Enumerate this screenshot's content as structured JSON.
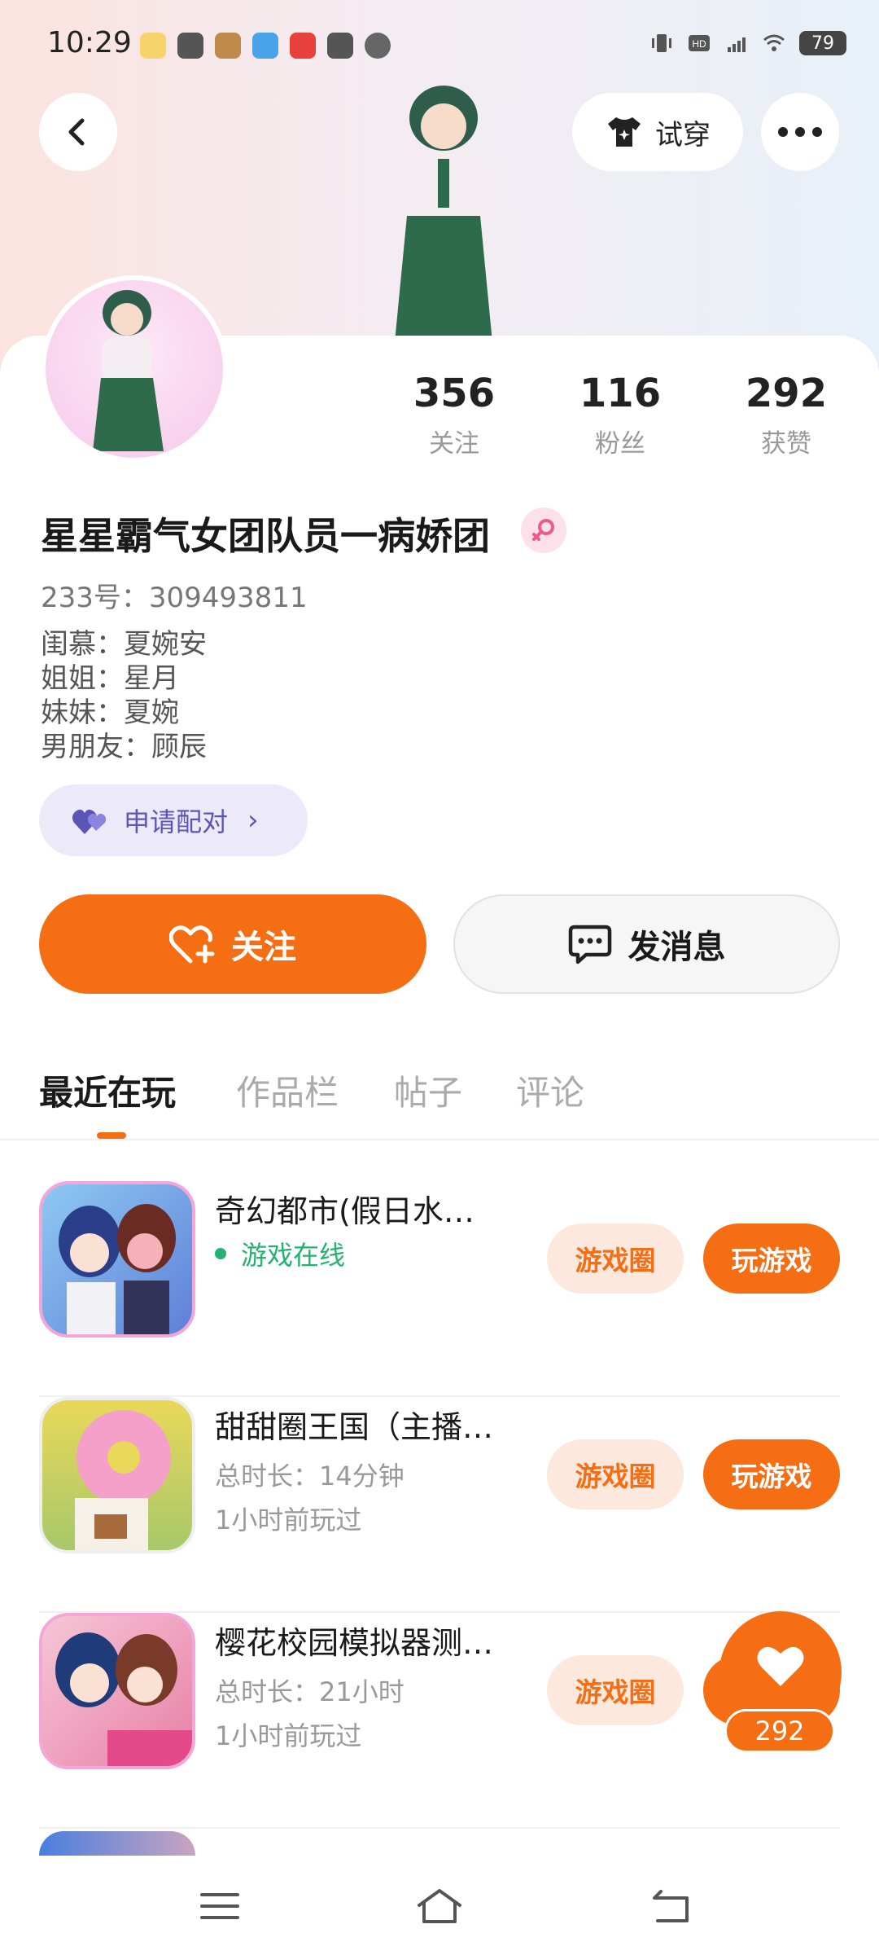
{
  "status_bar": {
    "time": "10:29",
    "battery": "79"
  },
  "header": {
    "try_on_label": "试穿"
  },
  "stats": [
    {
      "value": "356",
      "label": "关注"
    },
    {
      "value": "116",
      "label": "粉丝"
    },
    {
      "value": "292",
      "label": "获赞"
    }
  ],
  "profile": {
    "username": "星星霸气女团队员一病娇团",
    "uid": "233号：309493811",
    "bio_lines": [
      "闺慕：夏婉安",
      "姐姐：星月",
      "妹妹：夏婉",
      "男朋友：顾辰"
    ],
    "pair_label": "申请配对"
  },
  "actions": {
    "follow_label": "关注",
    "message_label": "发消息"
  },
  "tabs": [
    "最近在玩",
    "作品栏",
    "帖子",
    "评论"
  ],
  "games": [
    {
      "title": "奇幻都市(假日水…",
      "status": "游戏在线",
      "circle_label": "游戏圈",
      "play_label": "玩游戏"
    },
    {
      "title": "甜甜圈王国（主播…",
      "duration": "总时长：14分钟",
      "last_played": "1小时前玩过",
      "circle_label": "游戏圈",
      "play_label": "玩游戏"
    },
    {
      "title": "樱花校园模拟器测…",
      "duration": "总时长：21小时",
      "last_played": "1小时前玩过",
      "circle_label": "游戏圈",
      "play_label": "玩游戏"
    }
  ],
  "like_float": {
    "count": "292"
  },
  "colors": {
    "accent": "#f56e14",
    "online": "#23b36e",
    "pair": "#5b55b8"
  }
}
